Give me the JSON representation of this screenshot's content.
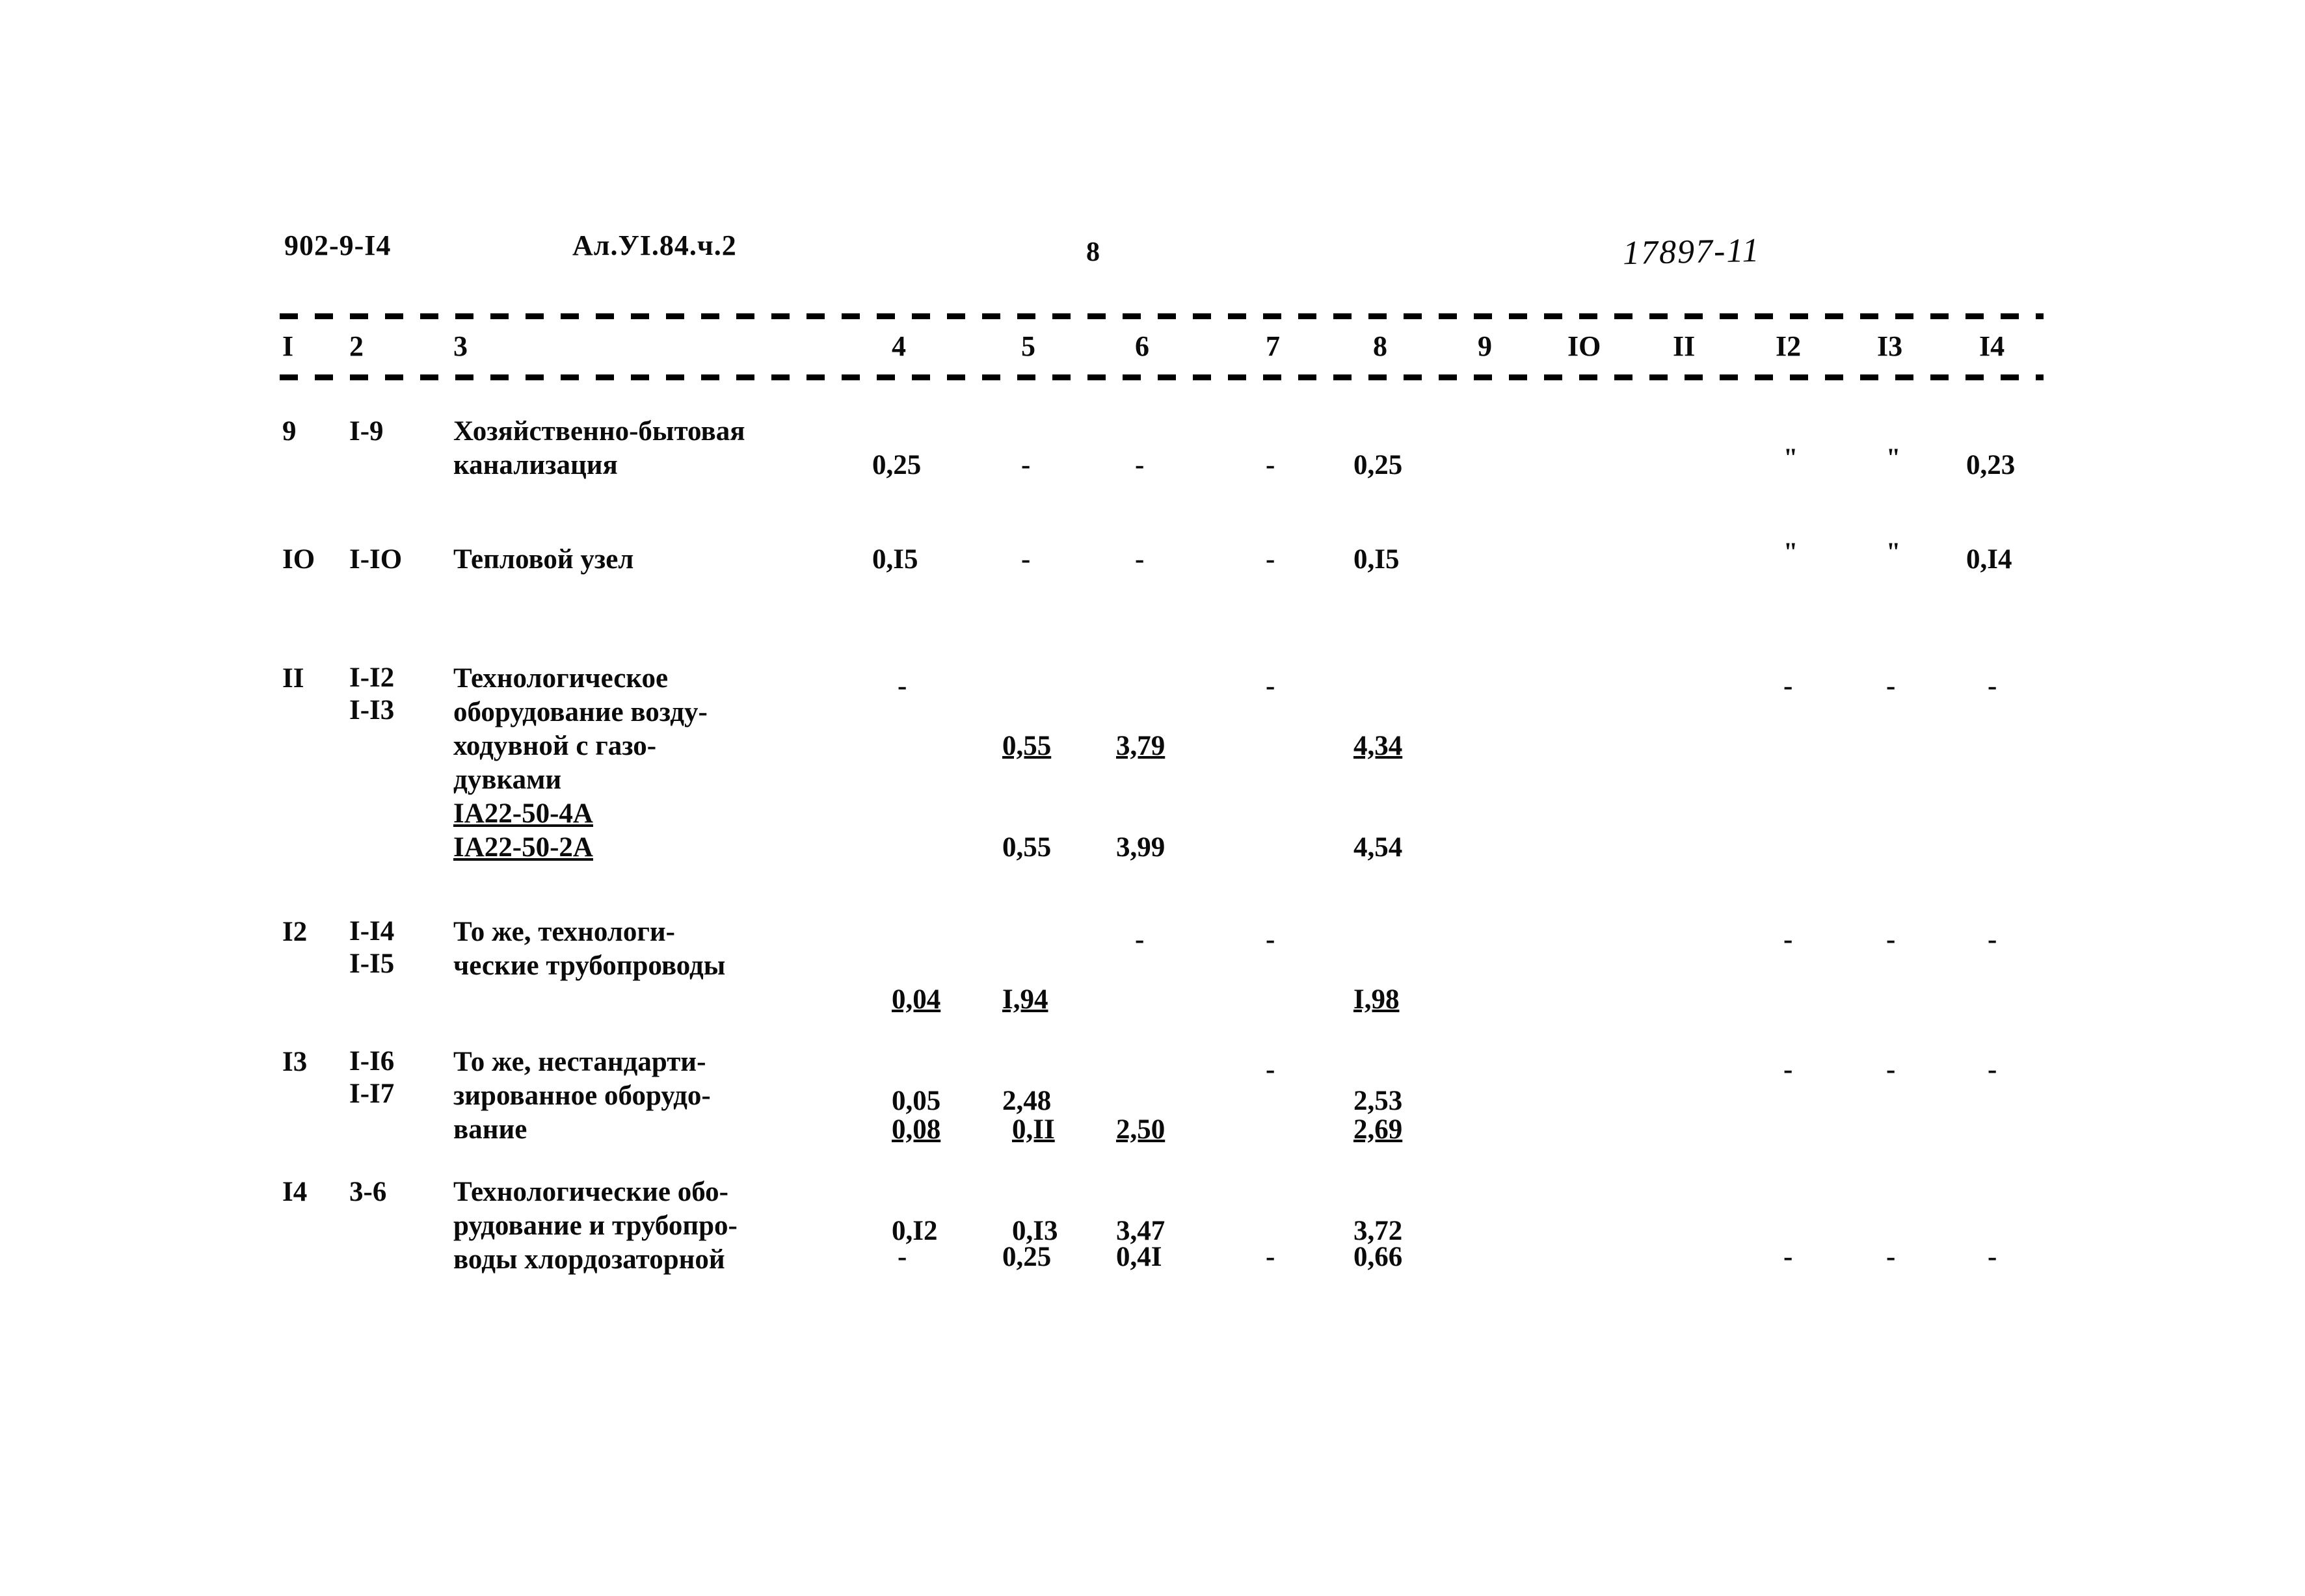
{
  "header": {
    "doc_code": "902-9-I4",
    "album_ref": "Ал.УI.84.ч.2",
    "page_number": "8",
    "stamp_number": "17897-11"
  },
  "table": {
    "column_headers": [
      "I",
      "2",
      "3",
      "4",
      "5",
      "6",
      "7",
      "8",
      "9",
      "IO",
      "II",
      "I2",
      "I3",
      "I4"
    ],
    "rows": [
      {
        "no": "9",
        "code": "I-9",
        "description": "Хозяйственно-бытовая\nканализация",
        "c4": "0,25",
        "c5": "-",
        "c6": "-",
        "c7": "-",
        "c8": "0,25",
        "c12": "\"",
        "c13": "\"",
        "c14": "0,23"
      },
      {
        "no": "IO",
        "code": "I-IO",
        "description": "Тепловой узел",
        "c4": "0,I5",
        "c5": "-",
        "c6": "-",
        "c7": "-",
        "c8": "0,I5",
        "c12": "\"",
        "c13": "\"",
        "c14": "0,I4"
      },
      {
        "no": "II",
        "code": "I-I2\nI-I3",
        "description": "Технологическое\nоборудование возду-\nходувной с газо-\nдувками",
        "subcodes": "IА22-50-4А\nIА22-50-2А",
        "c4": "-",
        "c5_top": "0,55",
        "c5_bot": "0,55",
        "c6_top": "3,79",
        "c6_bot": "3,99",
        "c7": "-",
        "c8_top": "4,34",
        "c8_bot": "4,54",
        "c12": "-",
        "c13": "-",
        "c14": "-"
      },
      {
        "no": "I2",
        "code": "I-I4\nI-I5",
        "description": "То же, технологи-\nческие трубопроводы",
        "c4_top": "0,04",
        "c4_bot": "0,05",
        "c5_top": "I,94",
        "c5_bot": "2,48",
        "c6": "-",
        "c7": "-",
        "c8_top": "I,98",
        "c8_bot": "2,53",
        "c12": "-",
        "c13": "-",
        "c14": "-"
      },
      {
        "no": "I3",
        "code": "I-I6\nI-I7",
        "description": "То же, нестандарти-\nзированное оборудо-\nвание",
        "c4_top": "0,08",
        "c4_bot": "0,I2",
        "c5_top": "0,II",
        "c5_bot": "0,I3",
        "c6_top": "2,50",
        "c6_bot": "3,47",
        "c7": "-",
        "c8_top": "2,69",
        "c8_bot": "3,72",
        "c12": "-",
        "c13": "-",
        "c14": "-"
      },
      {
        "no": "I4",
        "code": "3-6",
        "description": "Технологические обо-\nрудование и трубопро-\nводы хлордозаторной",
        "c4": "-",
        "c5": "0,25",
        "c6": "0,4I",
        "c7": "-",
        "c8": "0,66",
        "c12": "-",
        "c13": "-",
        "c14": "-"
      }
    ]
  }
}
